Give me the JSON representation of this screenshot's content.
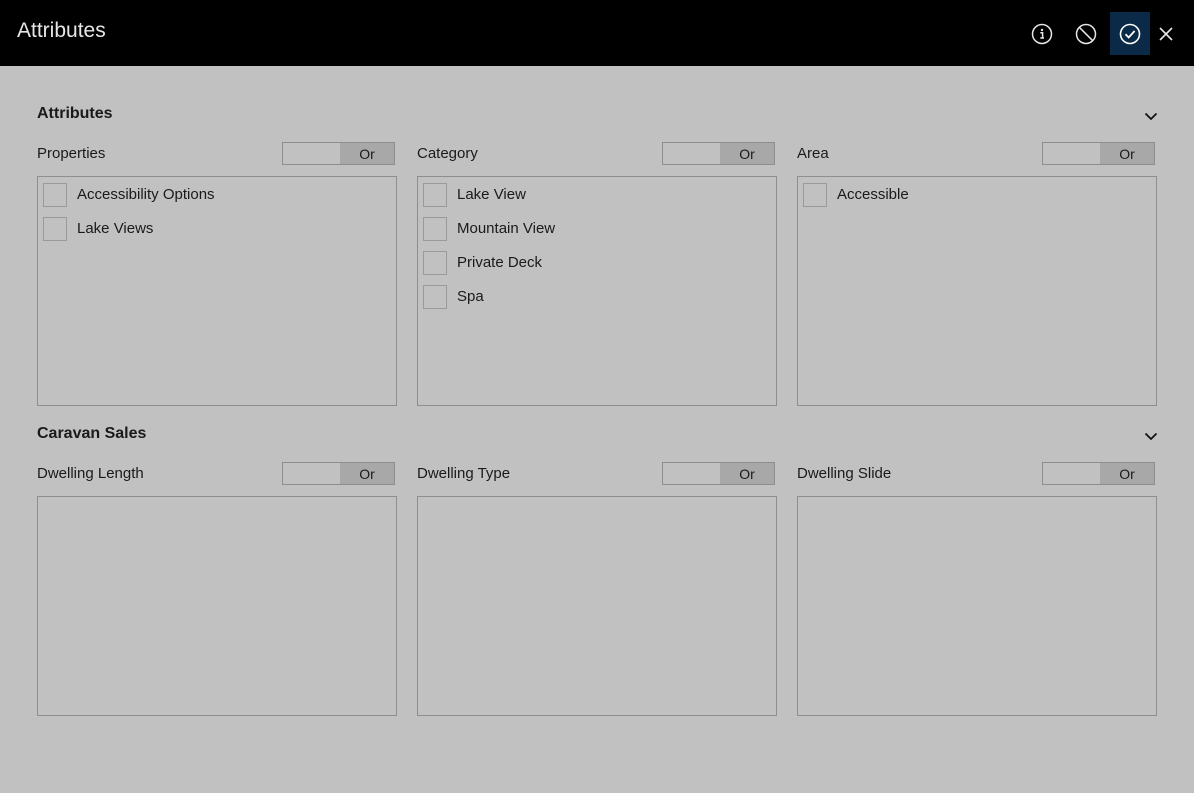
{
  "header": {
    "title": "Attributes",
    "icons": [
      "info-icon",
      "cancel-icon",
      "confirm-icon",
      "close-icon"
    ]
  },
  "sections": [
    {
      "title": "Attributes",
      "panels": [
        {
          "label": "Properties",
          "toggle": "Or",
          "items": [
            "Accessibility Options",
            "Lake Views"
          ]
        },
        {
          "label": "Category",
          "toggle": "Or",
          "items": [
            "Lake View",
            "Mountain View",
            "Private Deck",
            "Spa"
          ]
        },
        {
          "label": "Area",
          "toggle": "Or",
          "items": [
            "Accessible"
          ]
        }
      ]
    },
    {
      "title": "Caravan Sales",
      "panels": [
        {
          "label": "Dwelling Length",
          "toggle": "Or",
          "items": []
        },
        {
          "label": "Dwelling Type",
          "toggle": "Or",
          "items": []
        },
        {
          "label": "Dwelling Slide",
          "toggle": "Or",
          "items": []
        }
      ]
    }
  ]
}
